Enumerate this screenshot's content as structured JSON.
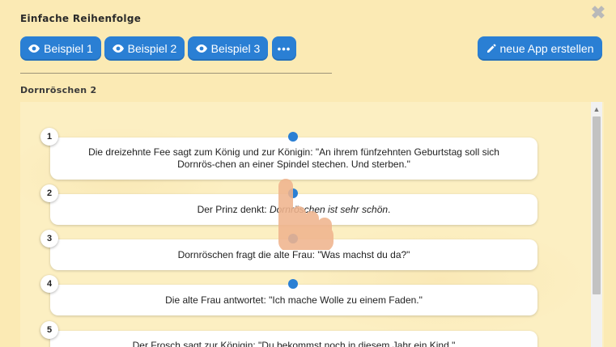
{
  "header": {
    "title": "Einfache Reihenfolge",
    "close_glyph": "✖"
  },
  "toolbar": {
    "example1_label": "Beispiel 1",
    "example2_label": "Beispiel 2",
    "example3_label": "Beispiel 3",
    "more_label": "•••",
    "new_app_label": "neue App erstellen",
    "accent_color": "#2a7fd4"
  },
  "section": {
    "title": "Dornröschen 2"
  },
  "items": [
    {
      "number": "1",
      "text": "Die dreizehnte Fee sagt zum König und zur Königin: \"An ihrem fünfzehnten Geburtstag soll sich Dornrös-chen an einer Spindel stechen. Und sterben.\""
    },
    {
      "number": "2",
      "text_before": "Der Prinz denkt: ",
      "text_italic": "Dornröschen ist sehr schön",
      "text_after": "."
    },
    {
      "number": "3",
      "text": "Dornröschen fragt die alte Frau: \"Was machst du da?\""
    },
    {
      "number": "4",
      "text": "Die alte Frau antwortet: \"Ich mache Wolle zu einem Faden.\""
    },
    {
      "number": "5",
      "text": "Der Frosch sagt zur Königin: \"Du bekommst noch in diesem Jahr ein Kind.\""
    }
  ],
  "icons": {
    "eye": "eye-icon",
    "pencil": "pencil-icon",
    "close": "close-icon",
    "hand": "hand-pointer-icon"
  }
}
